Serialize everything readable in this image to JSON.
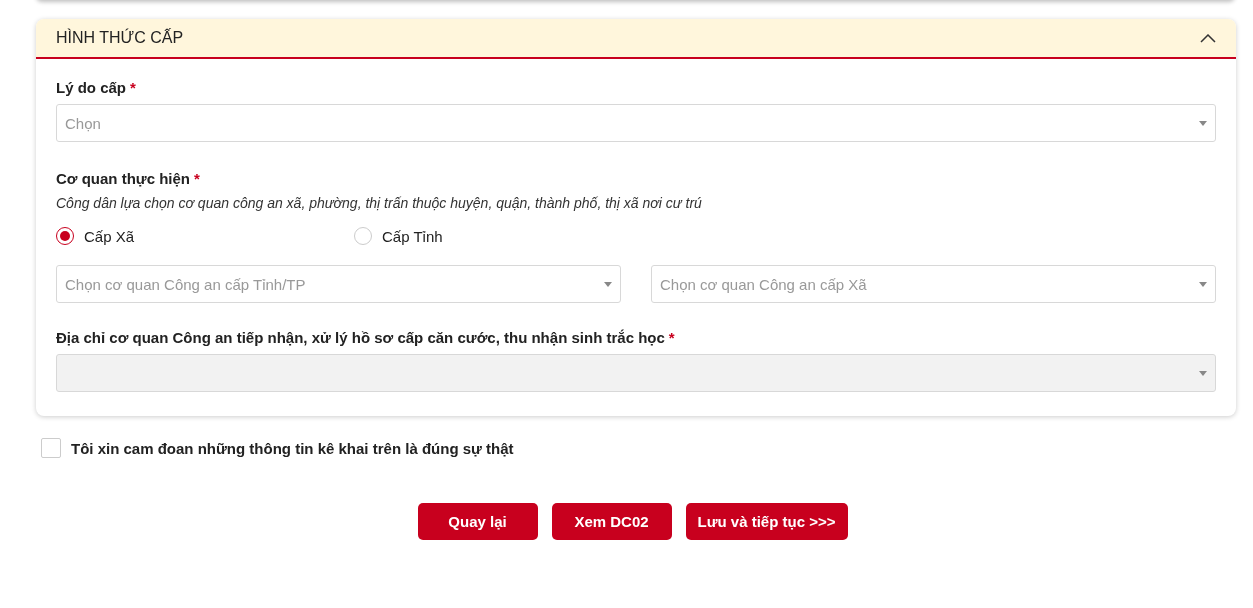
{
  "section": {
    "title": "HÌNH THỨC CẤP",
    "expanded": true,
    "reason": {
      "label": "Lý do cấp",
      "required_mark": "*",
      "placeholder": "Chọn",
      "disabled": false
    },
    "agency": {
      "label": "Cơ quan thực hiện",
      "required_mark": "*",
      "hint": "Công dân lựa chọn cơ quan công an xã, phường, thị trấn thuộc huyện, quận, thành phố, thị xã nơi cư trú",
      "options": [
        {
          "label": "Cấp Xã",
          "selected": true
        },
        {
          "label": "Cấp Tỉnh",
          "selected": false
        }
      ],
      "selects": [
        {
          "placeholder": "Chọn cơ quan Công an cấp Tỉnh/TP",
          "disabled": false
        },
        {
          "placeholder": "Chọn cơ quan Công an cấp Xã",
          "disabled": false
        }
      ]
    },
    "address": {
      "label": "Địa chỉ cơ quan Công an tiếp nhận, xử lý hồ sơ cấp căn cước, thu nhận sinh trắc học",
      "required_mark": "*",
      "disabled": true
    }
  },
  "commitment": {
    "label": "Tôi xin cam đoan những thông tin kê khai trên là đúng sự thật",
    "checked": false
  },
  "buttons": [
    "Quay lại",
    "Xem DC02",
    "Lưu và tiếp tục >>>"
  ]
}
